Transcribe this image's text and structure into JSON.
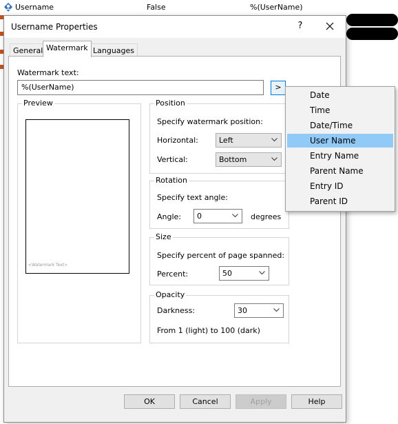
{
  "background_row": {
    "name": "Username",
    "value": "False",
    "expression": "%(UserName)"
  },
  "dialog": {
    "title": "Username Properties",
    "help_glyph": "?",
    "tabs": [
      "General",
      "Watermark",
      "Languages"
    ],
    "watermark_text_label": "Watermark text:",
    "watermark_text_value": "%(UserName)",
    "insert_button_label": ">",
    "preview": {
      "title": "Preview",
      "watermark_placeholder": "<Watermark Text>"
    },
    "position": {
      "title": "Position",
      "instruction": "Specify watermark position:",
      "horizontal_label": "Horizontal:",
      "horizontal_value": "Left",
      "vertical_label": "Vertical:",
      "vertical_value": "Bottom"
    },
    "rotation": {
      "title": "Rotation",
      "instruction": "Specify text angle:",
      "angle_label": "Angle:",
      "angle_value": "0",
      "unit": "degrees"
    },
    "size": {
      "title": "Size",
      "instruction": "Specify percent of page spanned:",
      "percent_label": "Percent:",
      "percent_value": "50"
    },
    "opacity": {
      "title": "Opacity",
      "darkness_label": "Darkness:",
      "darkness_value": "30",
      "range_note": "From 1 (light) to 100 (dark)"
    },
    "buttons": {
      "ok": "OK",
      "cancel": "Cancel",
      "apply": "Apply",
      "help": "Help"
    }
  },
  "token_menu": {
    "items": [
      "Date",
      "Time",
      "Date/Time",
      "User Name",
      "Entry Name",
      "Parent Name",
      "Entry ID",
      "Parent ID"
    ],
    "selected": "User Name"
  },
  "colors": {
    "selection": "#91c9f7",
    "focus_border": "#0078d7",
    "dialog_bg": "#f0f0f0"
  }
}
